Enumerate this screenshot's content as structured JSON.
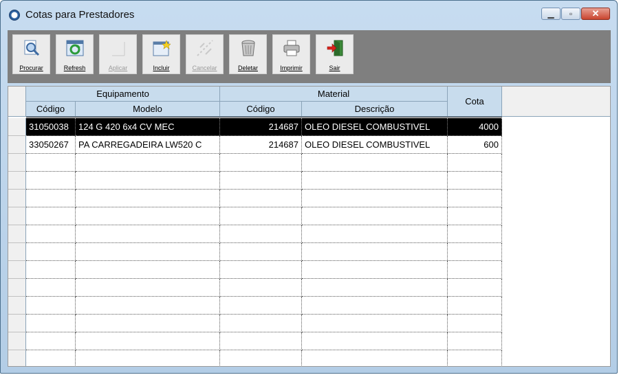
{
  "window": {
    "title": "Cotas para Prestadores",
    "controls": [
      "minimize",
      "maximize",
      "close"
    ]
  },
  "toolbar": {
    "buttons": [
      {
        "label": "Procurar",
        "icon": "search-icon",
        "enabled": true
      },
      {
        "label": "Refresh",
        "icon": "refresh-icon",
        "enabled": true
      },
      {
        "label": "Aplicar",
        "icon": "apply-icon",
        "enabled": false
      },
      {
        "label": "Incluir",
        "icon": "new-icon",
        "enabled": true
      },
      {
        "label": "Cancelar",
        "icon": "cancel-icon",
        "enabled": false
      },
      {
        "label": "Deletar",
        "icon": "trash-icon",
        "enabled": true
      },
      {
        "label": "Imprimir",
        "icon": "printer-icon",
        "enabled": true
      },
      {
        "label": "Sair",
        "icon": "exit-icon",
        "enabled": true
      }
    ]
  },
  "grid": {
    "group_headers": {
      "equipamento": "Equipamento",
      "material": "Material",
      "cota": "Cota"
    },
    "column_headers": {
      "eq_codigo": "Código",
      "eq_modelo": "Modelo",
      "mat_codigo": "Código",
      "mat_descricao": "Descrição"
    },
    "rows": [
      {
        "eq_codigo": "31050038",
        "eq_modelo": "124 G 420 6x4 CV MEC",
        "mat_codigo": "214687",
        "mat_descricao": "OLEO DIESEL COMBUSTIVEL",
        "cota": "4000",
        "selected": true
      },
      {
        "eq_codigo": "33050267",
        "eq_modelo": "PA CARREGADEIRA LW520 C",
        "mat_codigo": "214687",
        "mat_descricao": "OLEO DIESEL COMBUSTIVEL",
        "cota": "600",
        "selected": false
      }
    ]
  }
}
